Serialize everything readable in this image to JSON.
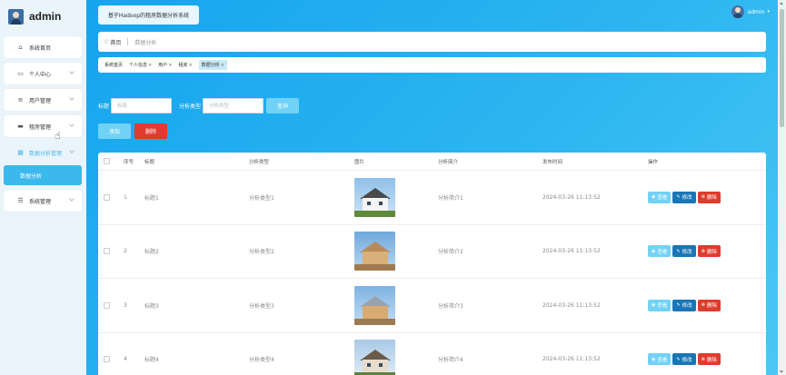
{
  "brand": {
    "name": "admin"
  },
  "sidebar": {
    "items": [
      {
        "label": "系统首页",
        "icon": "home-icon",
        "glyph": "⌂"
      },
      {
        "label": "个人中心",
        "icon": "id-card-icon",
        "glyph": "▭"
      },
      {
        "label": "用户管理",
        "icon": "list-icon",
        "glyph": "≡"
      },
      {
        "label": "租房管理",
        "icon": "monitor-icon",
        "glyph": "▬"
      },
      {
        "label": "数据分析管理",
        "icon": "grid-icon",
        "glyph": "▦"
      },
      {
        "label": "系统管理",
        "icon": "sliders-icon",
        "glyph": "☰"
      }
    ],
    "submenu": {
      "label": "数据分析"
    }
  },
  "header": {
    "title": "基于Hadoop的租房数据分析系统",
    "user": "admin",
    "caret": "▾"
  },
  "breadcrumb": {
    "home": "首页",
    "current": "数据分析",
    "home_glyph": "♡"
  },
  "tabs": [
    {
      "label": "系统首页",
      "closable": false
    },
    {
      "label": "个人信息",
      "closable": true
    },
    {
      "label": "用户",
      "closable": true
    },
    {
      "label": "租房",
      "closable": true
    },
    {
      "label": "数据分析",
      "closable": true
    }
  ],
  "tab_close": "×",
  "search": {
    "title_label": "标题",
    "title_placeholder": "标题",
    "type_label": "分析类型",
    "type_placeholder": "分析类型",
    "query_button": "查询"
  },
  "actions": {
    "add": "添加",
    "delete": "删除"
  },
  "table": {
    "headers": {
      "index": "序号",
      "title": "标题",
      "type": "分析类型",
      "image": "图片",
      "brief": "分析简介",
      "time": "发布时间",
      "ops": "操作"
    },
    "rows": [
      {
        "index": "1",
        "title": "标题1",
        "type": "分析类型1",
        "brief": "分析简介1",
        "time": "2024-03-26 11:13:52"
      },
      {
        "index": "2",
        "title": "标题2",
        "type": "分析类型2",
        "brief": "分析简介2",
        "time": "2024-03-26 11:13:52"
      },
      {
        "index": "3",
        "title": "标题3",
        "type": "分析类型3",
        "brief": "分析简介3",
        "time": "2024-03-26 11:13:52"
      },
      {
        "index": "4",
        "title": "标题4",
        "type": "分析类型4",
        "brief": "分析简介4",
        "time": "2024-03-26 11:13:52"
      }
    ],
    "op_labels": {
      "view": "查看",
      "edit": "修改",
      "delete": "删除"
    },
    "op_glyphs": {
      "view": "◉",
      "edit": "✎",
      "delete": "⊗"
    }
  },
  "colors": {
    "accent": "#3bb8ec",
    "danger": "#e03b2d",
    "primary": "#1976b6",
    "main_bg": "#1da9ef"
  }
}
